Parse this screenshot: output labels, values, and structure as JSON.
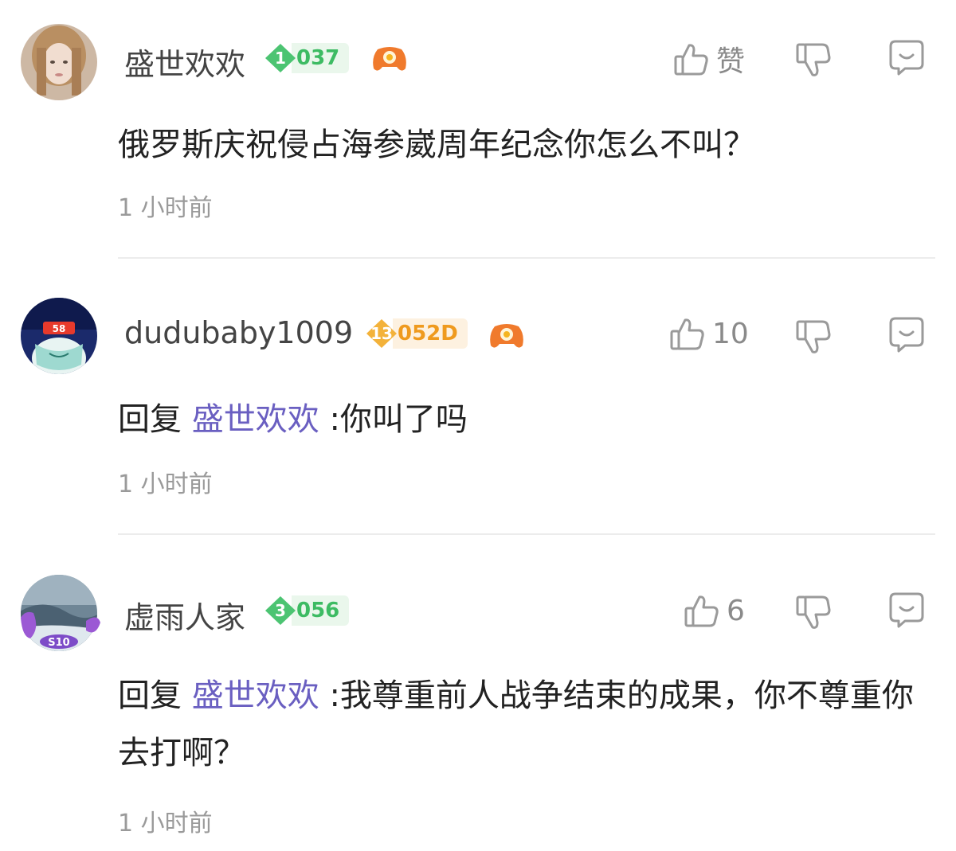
{
  "comments": [
    {
      "username": "盛世欢欢",
      "level": "1",
      "badge_code": "037",
      "badge_color": "green",
      "likes_label": "赞",
      "reply_prefix": "",
      "mention": "",
      "text": "俄罗斯庆祝侵占海参崴周年纪念你怎么不叫？",
      "time": "1 小时前",
      "has_game_icon": true
    },
    {
      "username": "dudubaby1009",
      "level": "13",
      "badge_code": "052D",
      "badge_color": "orange",
      "likes_label": "10",
      "reply_prefix": "回复",
      "mention": "盛世欢欢",
      "text": " :你叫了吗",
      "time": "1 小时前",
      "has_game_icon": true
    },
    {
      "username": "虚雨人家",
      "level": "3",
      "badge_code": "056",
      "badge_color": "green",
      "likes_label": "6",
      "reply_prefix": "回复",
      "mention": "盛世欢欢",
      "text": " :我尊重前人战争结束的成果，你不尊重你去打啊？",
      "time": "1 小时前",
      "has_game_icon": false
    }
  ],
  "colors": {
    "mention": "#6a5fc1",
    "badge_green": "#3dbb63",
    "badge_orange": "#ef9a1e",
    "icon_gray": "#9a9a9a"
  },
  "icons": {
    "like": "thumbs-up-icon",
    "dislike": "thumbs-down-icon",
    "reply": "chat-bubble-icon",
    "game": "gamepad-icon"
  }
}
